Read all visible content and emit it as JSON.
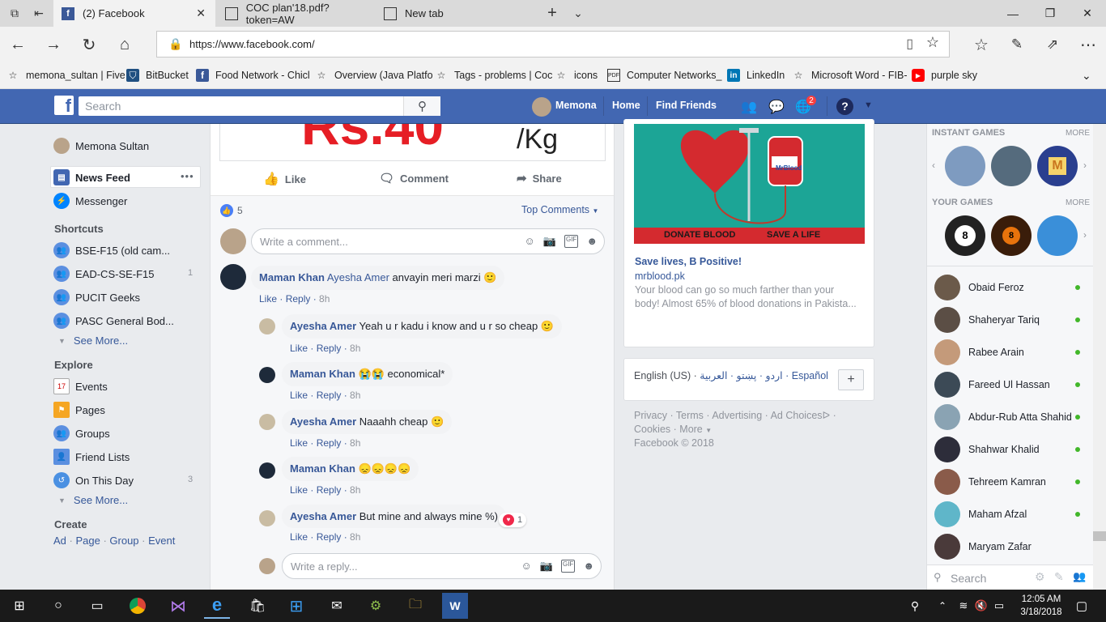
{
  "browser": {
    "tabs": [
      {
        "title": "(2) Facebook",
        "icon": "facebook-icon"
      },
      {
        "title": "COC plan'18.pdf?token=AW",
        "icon": "pdf-icon"
      },
      {
        "title": "New tab",
        "icon": "newtab-icon"
      }
    ],
    "url": "https://www.facebook.com/",
    "favorites": [
      "memona_sultan | Five",
      "BitBucket",
      "Food Network - Chicl",
      "Overview (Java Platfo",
      "Tags - problems | Coc",
      "icons",
      "Computer Networks_",
      "LinkedIn",
      "Microsoft Word - FIB-",
      "purple sky"
    ]
  },
  "fb": {
    "search_placeholder": "Search",
    "profile_name": "Memona",
    "nav_home": "Home",
    "nav_find_friends": "Find Friends",
    "notif_count": "2"
  },
  "left": {
    "user_name": "Memona Sultan",
    "news_feed": "News Feed",
    "news_feed_more": "•••",
    "messenger": "Messenger",
    "shortcuts_title": "Shortcuts",
    "shortcuts": [
      {
        "label": "BSE-F15 (old cam...",
        "count": ""
      },
      {
        "label": "EAD-CS-SE-F15",
        "count": "1"
      },
      {
        "label": "PUCIT Geeks",
        "count": ""
      },
      {
        "label": "PASC General Bod...",
        "count": ""
      }
    ],
    "see_more_1": "See More...",
    "explore_title": "Explore",
    "explore": [
      {
        "label": "Events",
        "count": ""
      },
      {
        "label": "Pages",
        "count": ""
      },
      {
        "label": "Groups",
        "count": ""
      },
      {
        "label": "Friend Lists",
        "count": ""
      },
      {
        "label": "On This Day",
        "count": "3"
      }
    ],
    "see_more_2": "See More...",
    "create_title": "Create",
    "create_links": [
      "Ad",
      "Page",
      "Group",
      "Event"
    ]
  },
  "post": {
    "price_text": "Rs.40",
    "price_unit": "/Kg",
    "like_label": "Like",
    "comment_label": "Comment",
    "share_label": "Share",
    "reaction_count": "5",
    "top_comments": "Top Comments",
    "comment_placeholder": "Write a comment...",
    "reply_placeholder": "Write a reply...",
    "comments": [
      {
        "author": "Maman Khan",
        "tag": "Ayesha Amer",
        "text": "anvayin meri marzi",
        "emoji": "🙂",
        "like": "Like",
        "reply": "Reply",
        "time": "8h"
      },
      {
        "author": "Ayesha Amer",
        "tag": "",
        "text": "Yeah u r kadu i know and u r so cheap",
        "emoji": "🙂",
        "like": "Like",
        "reply": "Reply",
        "time": "8h"
      },
      {
        "author": "Maman Khan",
        "tag": "",
        "text": "economical*",
        "emoji": "😭😭",
        "like": "Like",
        "reply": "Reply",
        "time": "8h"
      },
      {
        "author": "Ayesha Amer",
        "tag": "",
        "text": "Naaahh cheap",
        "emoji": "🙂",
        "like": "Like",
        "reply": "Reply",
        "time": "8h"
      },
      {
        "author": "Maman Khan",
        "tag": "",
        "text": "",
        "emoji": "😞😞😞😞",
        "like": "Like",
        "reply": "Reply",
        "time": "8h"
      },
      {
        "author": "Ayesha Amer",
        "tag": "",
        "text": "But mine and always mine %)",
        "emoji": "",
        "like": "Like",
        "reply": "Reply",
        "time": "8h",
        "reactions": "1"
      }
    ]
  },
  "ad": {
    "donate_label": "DONATE BLOOD",
    "save_label": "SAVE A LIFE",
    "bag_label": "MrBlood",
    "title": "Save lives, B Positive!",
    "domain": "mrblood.pk",
    "body": "Your blood can go so much farther than your body! Almost 65% of blood donations in Pakista..."
  },
  "languages": {
    "current": "English (US)",
    "others": "اردو · پښتو · العربية ·",
    "espanol": "Español",
    "add": "+"
  },
  "footer": {
    "line1": [
      "Privacy",
      "Terms",
      "Advertising",
      "Ad Choices"
    ],
    "line2": [
      "Cookies",
      "More"
    ],
    "copyright": "Facebook © 2018"
  },
  "chat": {
    "instant_games": "INSTANT GAMES",
    "your_games": "YOUR GAMES",
    "more": "MORE",
    "search": "Search",
    "friends": [
      "Obaid Feroz",
      "Shaheryar Tariq",
      "Rabee Arain",
      "Fareed Ul Hassan",
      "Abdur-Rub Atta Shahid",
      "Shahwar Khalid",
      "Tehreem Kamran",
      "Maham Afzal",
      "Maryam Zafar"
    ]
  },
  "taskbar": {
    "time": "12:05 AM",
    "date": "3/18/2018"
  }
}
